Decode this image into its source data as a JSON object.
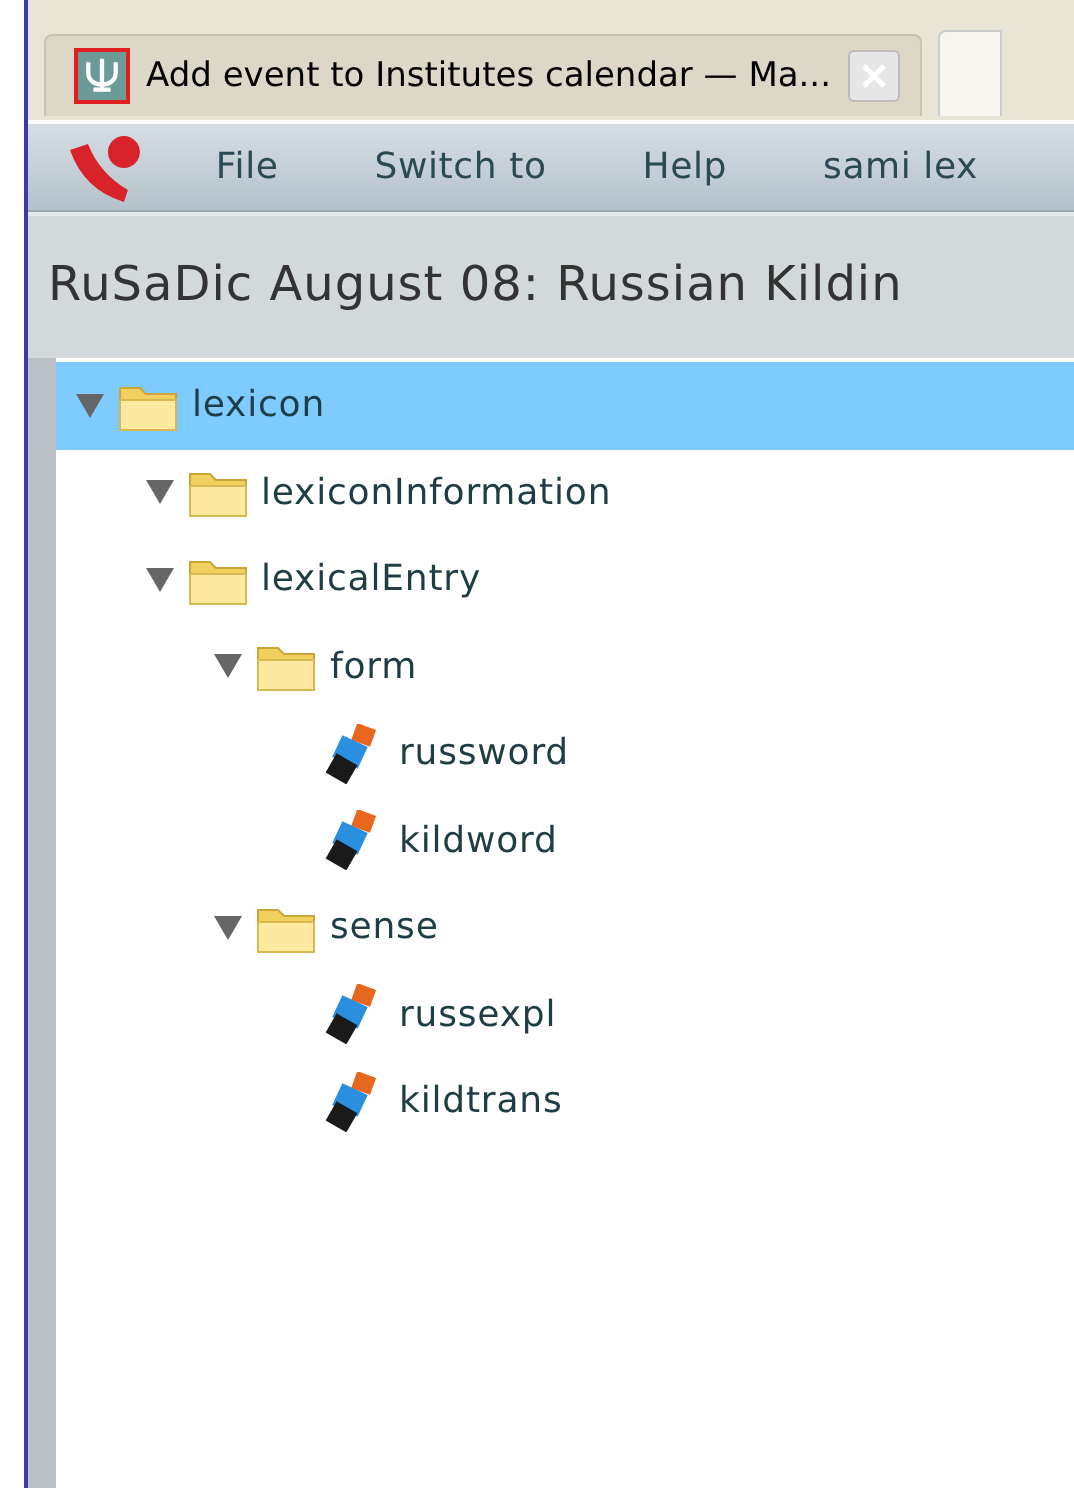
{
  "tabs": [
    {
      "title": "Add event to Institutes calendar — Ma...",
      "selected": true
    }
  ],
  "menu": {
    "items": [
      "File",
      "Switch to",
      "Help",
      "sami lex"
    ]
  },
  "page_title": "RuSaDic August 08: Russian Kildin",
  "tree": [
    {
      "label": "lexicon",
      "kind": "folder",
      "expanded": true,
      "selected": true,
      "children": [
        {
          "label": "lexiconInformation",
          "kind": "folder",
          "expanded": true,
          "selected": false
        },
        {
          "label": "lexicalEntry",
          "kind": "folder",
          "expanded": true,
          "selected": false,
          "children": [
            {
              "label": "form",
              "kind": "folder",
              "expanded": true,
              "selected": false,
              "children": [
                {
                  "label": "russword",
                  "kind": "element",
                  "selected": false
                },
                {
                  "label": "kildword",
                  "kind": "element",
                  "selected": false
                }
              ]
            },
            {
              "label": "sense",
              "kind": "folder",
              "expanded": true,
              "selected": false,
              "children": [
                {
                  "label": "russexpl",
                  "kind": "element",
                  "selected": false
                },
                {
                  "label": "kildtrans",
                  "kind": "element",
                  "selected": false
                }
              ]
            }
          ]
        }
      ]
    }
  ]
}
